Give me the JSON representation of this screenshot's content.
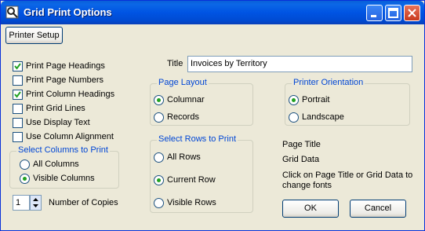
{
  "window": {
    "title": "Grid Print Options"
  },
  "toolbar": {
    "printer_setup_label": "Printer Setup"
  },
  "options": [
    {
      "label": "Print Page Headings",
      "checked": true
    },
    {
      "label": "Print Page Numbers",
      "checked": false
    },
    {
      "label": "Print Column Headings",
      "checked": true
    },
    {
      "label": "Print Grid Lines",
      "checked": false
    },
    {
      "label": "Use Display Text",
      "checked": false
    },
    {
      "label": "Use Column Alignment",
      "checked": false
    }
  ],
  "select_columns": {
    "legend": "Select Columns to Print",
    "items": [
      {
        "label": "All Columns",
        "selected": false
      },
      {
        "label": "Visible Columns",
        "selected": true
      }
    ]
  },
  "copies": {
    "value": "1",
    "label": "Number of Copies"
  },
  "title_field": {
    "label": "Title",
    "value": "Invoices by Territory"
  },
  "page_layout": {
    "legend": "Page Layout",
    "items": [
      {
        "label": "Columnar",
        "selected": true
      },
      {
        "label": "Records",
        "selected": false
      }
    ]
  },
  "rows_to_print": {
    "legend": "Select Rows to Print",
    "items": [
      {
        "label": "All Rows",
        "selected": false
      },
      {
        "label": "Current Row",
        "selected": true
      },
      {
        "label": "Visible Rows",
        "selected": false
      }
    ]
  },
  "orientation": {
    "legend": "Printer Orientation",
    "items": [
      {
        "label": "Portrait",
        "selected": true
      },
      {
        "label": "Landscape",
        "selected": false
      }
    ]
  },
  "fonts": {
    "page_title": "Page Title",
    "grid_data": "Grid Data",
    "hint": "Click on Page Title or Grid Data to change fonts"
  },
  "buttons": {
    "ok": "OK",
    "cancel": "Cancel"
  },
  "colors": {
    "titlebar": "#0054e3",
    "group_legend": "#0046d5",
    "radio_dot": "#21a121",
    "check_mark": "#21a121"
  }
}
